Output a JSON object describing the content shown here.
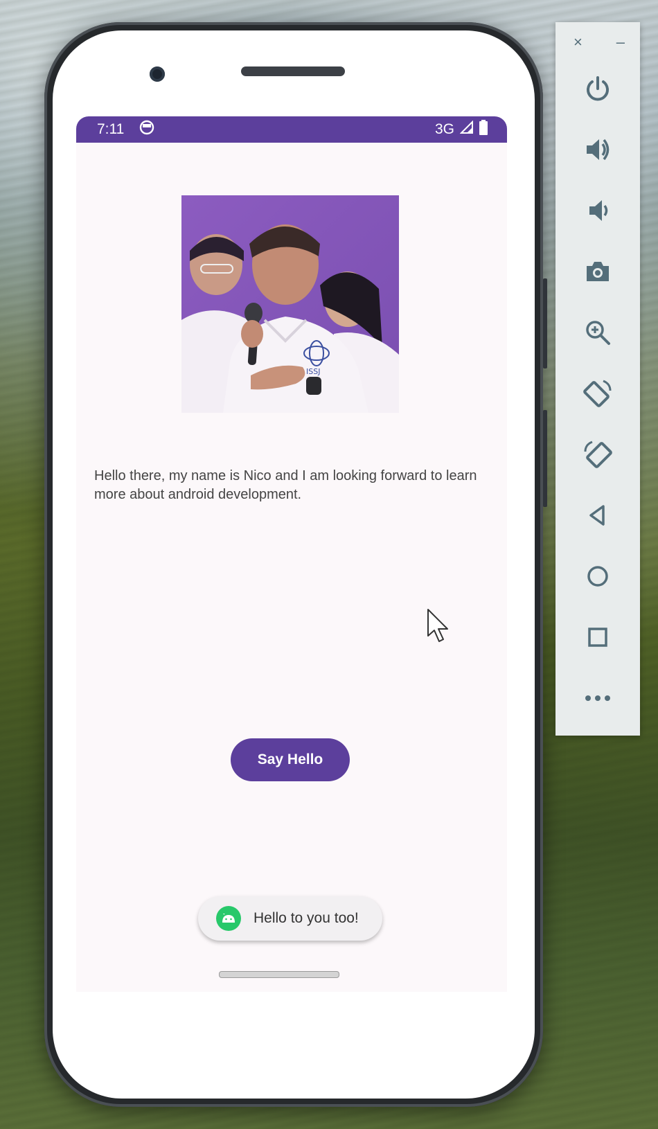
{
  "statusbar": {
    "time": "7:11",
    "network": "3G",
    "notification_icon": "android-head-icon",
    "signal_icon": "cell-signal-icon",
    "battery_icon": "battery-icon"
  },
  "app": {
    "photo_alt": "Profile photo of a student holding a microphone",
    "bio": "Hello there, my name is Nico and I am looking forward to learn more about android development.",
    "button_label": "Say Hello",
    "toast_text": "Hello to you too!"
  },
  "colors": {
    "primary": "#5c3f9c",
    "background": "#fcf8fa",
    "toast_icon": "#28c86a"
  },
  "emulator_toolbar": {
    "close_label": "×",
    "minimize_label": "–",
    "buttons": [
      "power-icon",
      "volume-up-icon",
      "volume-down-icon",
      "camera-icon",
      "zoom-icon",
      "rotate-left-icon",
      "rotate-right-icon",
      "back-icon",
      "home-icon",
      "overview-icon",
      "more-icon"
    ]
  }
}
